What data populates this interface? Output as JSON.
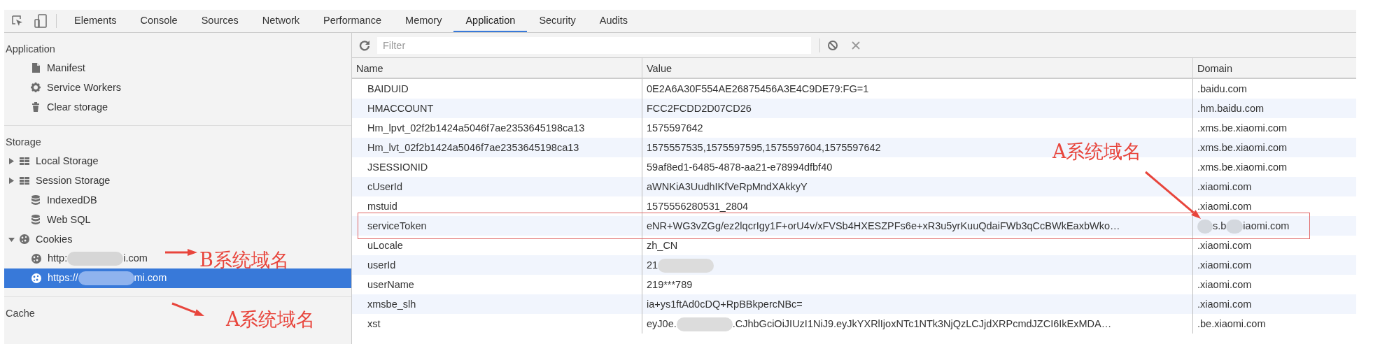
{
  "toolbar": {
    "tabs": [
      {
        "label": "Elements",
        "selected": false
      },
      {
        "label": "Console",
        "selected": false
      },
      {
        "label": "Sources",
        "selected": false
      },
      {
        "label": "Network",
        "selected": false
      },
      {
        "label": "Performance",
        "selected": false
      },
      {
        "label": "Memory",
        "selected": false
      },
      {
        "label": "Application",
        "selected": true
      },
      {
        "label": "Security",
        "selected": false
      },
      {
        "label": "Audits",
        "selected": false
      }
    ]
  },
  "sidebar": {
    "sections": [
      {
        "title": "Application",
        "items": [
          {
            "kind": "manifest",
            "label": "Manifest",
            "selected": false
          },
          {
            "kind": "workers",
            "label": "Service Workers",
            "selected": false
          },
          {
            "kind": "clear",
            "label": "Clear storage",
            "selected": false
          }
        ]
      },
      {
        "title": "Storage",
        "items": [
          {
            "kind": "keyvalue",
            "label": "Local Storage",
            "expanded": false,
            "selected": false
          },
          {
            "kind": "keyvalue",
            "label": "Session Storage",
            "expanded": false,
            "selected": false
          },
          {
            "kind": "database",
            "label": "IndexedDB",
            "selected": false
          },
          {
            "kind": "database",
            "label": "Web SQL",
            "selected": false
          },
          {
            "kind": "cookies",
            "label": "Cookies",
            "expanded": true,
            "selected": false,
            "children": [
              {
                "kind": "origin",
                "parts": [
                  "http:",
                  "i.com"
                ],
                "selected": false
              },
              {
                "kind": "origin",
                "parts": [
                  "https://",
                  "mi.com"
                ],
                "selected": true
              }
            ]
          }
        ]
      },
      {
        "title": "Cache"
      }
    ]
  },
  "filter": {
    "placeholder": "Filter"
  },
  "table": {
    "columns": [
      "Name",
      "Value",
      "Domain"
    ],
    "rows": [
      {
        "name": "BAIDUID",
        "value": "0E2A6A30F554AE26875456A3E4C9DE79:FG=1",
        "domain": ".baidu.com",
        "highlighted": false
      },
      {
        "name": "HMACCOUNT",
        "value": "FCC2FCDD2D07CD26",
        "domain": ".hm.baidu.com",
        "highlighted": false
      },
      {
        "name": "Hm_lpvt_02f2b1424a5046f7ae2353645198ca13",
        "value": "1575597642",
        "domain": ".xms.be.xiaomi.com",
        "highlighted": false
      },
      {
        "name": "Hm_lvt_02f2b1424a5046f7ae2353645198ca13",
        "value": "1575557535,1575597595,1575597604,1575597642",
        "domain": ".xms.be.xiaomi.com",
        "highlighted": false
      },
      {
        "name": "JSESSIONID",
        "value": "59af8ed1-6485-4878-aa21-e78994dfbf40",
        "domain": ".xms.be.xiaomi.com",
        "highlighted": false
      },
      {
        "name": "cUserId",
        "value": "aWNKiA3UudhIKfVeRpMndXAkkyY",
        "domain": ".xiaomi.com",
        "highlighted": false
      },
      {
        "name": "mstuid",
        "value": "1575556280531_2804",
        "domain": ".xiaomi.com",
        "highlighted": false
      },
      {
        "name": "serviceToken",
        "value": "eNR+WG3vZGg/ez2lqcrIgy1F+orU4v/xFVSb4HXESZPFs6e+xR3u5yrKuuQdaiFWb3qCcBWkEaxbWko…",
        "domain": {
          "parts": [
            "s.b",
            "iaomi.com"
          ],
          "lead_blur": true
        },
        "highlighted": true
      },
      {
        "name": "uLocale",
        "value": "zh_CN",
        "domain": ".xiaomi.com",
        "highlighted": false
      },
      {
        "name": "userId",
        "value": {
          "parts": [
            "21"
          ],
          "trail_blur": true
        },
        "domain": ".xiaomi.com",
        "highlighted": false
      },
      {
        "name": "userName",
        "value": "219***789",
        "domain": ".xiaomi.com",
        "highlighted": false
      },
      {
        "name": "xmsbe_slh",
        "value": "ia+ys1ftAd0cDQ+RpBBkpercNBc=",
        "domain": ".xiaomi.com",
        "highlighted": false
      },
      {
        "name": "xst",
        "value": {
          "parts": [
            "eyJ0e.",
            ".CJhbGciOiJIUzI1NiJ9.eyJkYXRlIjoxNTc1NTk3NjQzLCJjdXRPcmdJZCI6IkExMDA…"
          ]
        },
        "domain": ".be.xiaomi.com",
        "highlighted": false
      }
    ]
  },
  "annotations": [
    {
      "text": "B系统域名"
    },
    {
      "text": "A系统域名"
    },
    {
      "text": "A系统域名"
    }
  ]
}
